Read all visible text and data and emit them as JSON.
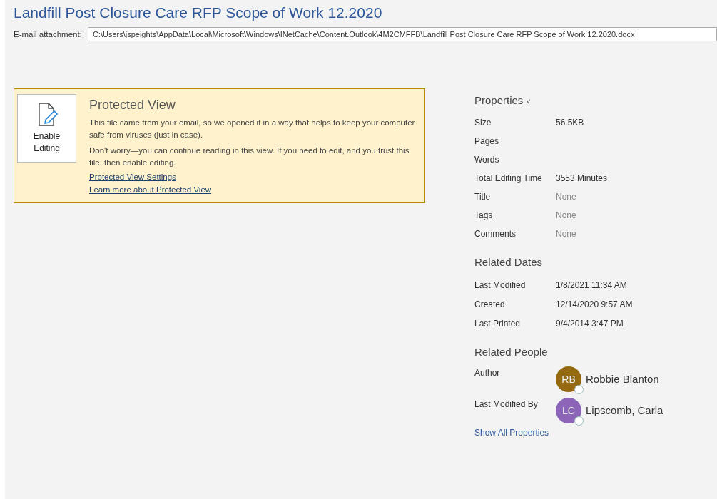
{
  "document": {
    "title": "Landfill Post Closure Care RFP Scope of Work 12.2020",
    "attachment_label": "E-mail attachment:",
    "attachment_path": "C:\\Users\\jspeights\\AppData\\Local\\Microsoft\\Windows\\INetCache\\Content.Outlook\\4M2CMFFB\\Landfill Post Closure Care RFP Scope of Work 12.2020.docx"
  },
  "protected_view": {
    "button_line_1": "Enable",
    "button_line_2": "Editing",
    "title": "Protected View",
    "paragraphs": [
      "This file came from your email, so we opened it in a way that helps to keep your computer safe from viruses (just in case).",
      "Don't worry—you can continue reading in this view. If you need to edit, and you trust this file, then enable editing."
    ],
    "links": [
      "Protected View Settings",
      "Learn more about Protected View"
    ]
  },
  "properties": {
    "heading": "Properties",
    "caret": "˅",
    "rows": [
      {
        "label": "Size",
        "value": "56.5KB",
        "muted": false
      },
      {
        "label": "Pages"
      },
      {
        "label": "Words"
      },
      {
        "label": "Total Editing Time",
        "value": "3553 Minutes",
        "muted": false
      },
      {
        "label": "Title",
        "value": "None",
        "muted": true
      },
      {
        "label": "Tags",
        "value": "None",
        "muted": true
      },
      {
        "label": "Comments",
        "value": "None",
        "muted": true
      }
    ]
  },
  "related_dates": {
    "heading": "Related Dates",
    "rows": [
      {
        "label": "Last Modified",
        "value": "1/8/2021 11:34 AM"
      },
      {
        "label": "Created",
        "value": "12/14/2020 9:57 AM"
      },
      {
        "label": "Last Printed",
        "value": "9/4/2014 3:47 PM"
      }
    ]
  },
  "related_people": {
    "heading": "Related People",
    "rows": [
      {
        "label": "Author",
        "initials": "RB",
        "name": "Robbie Blanton",
        "color": "#94690f"
      },
      {
        "label": "Last Modified By",
        "initials": "LC",
        "name": "Lipscomb, Carla",
        "color": "#8c64b8"
      }
    ],
    "link": "Show All Properties"
  }
}
